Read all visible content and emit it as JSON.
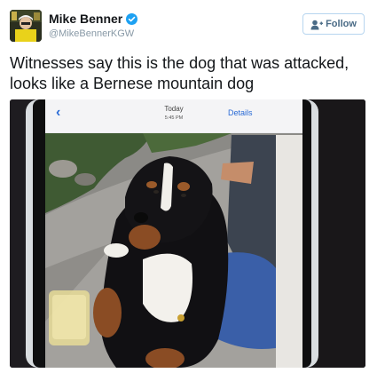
{
  "tweet": {
    "display_name": "Mike Benner",
    "handle": "@MikeBennerKGW",
    "follow_label": "Follow",
    "text": "Witnesses say this is the dog that was attacked, looks like a Bernese mountain dog"
  },
  "photo_screen": {
    "title": "Today",
    "time": "5:45 PM",
    "details_label": "Details",
    "back_icon": "‹"
  },
  "colors": {
    "verified": "#1da1f2",
    "follow_text": "#4a6b86",
    "follow_border": "#b7d5ef",
    "handle": "#8899a6",
    "ios_link": "#2a6bd6"
  },
  "icons": {
    "verified": "verified-badge-icon",
    "follow": "follow-user-icon",
    "back": "back-chevron-icon"
  }
}
